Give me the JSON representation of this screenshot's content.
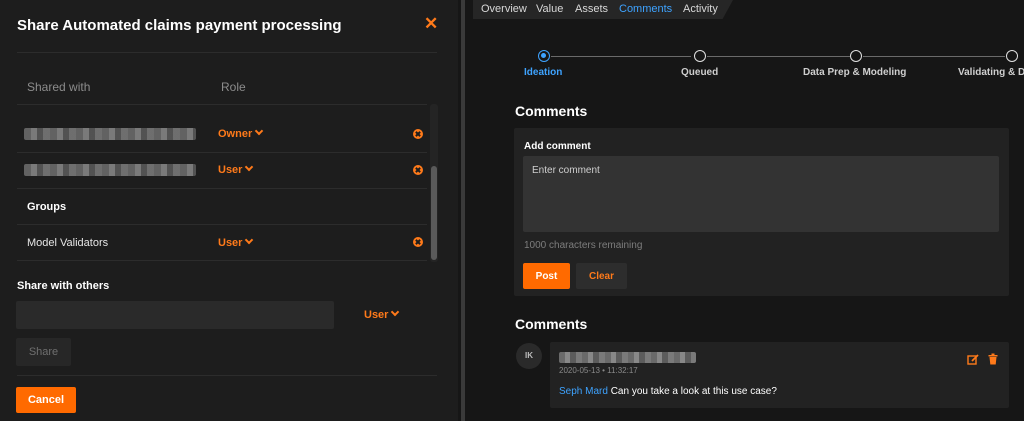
{
  "modal": {
    "title": "Share Automated claims payment processing",
    "close_icon": "close-icon",
    "columns": {
      "shared_with": "Shared with",
      "role": "Role"
    },
    "members": [
      {
        "name": "",
        "role": "Owner"
      },
      {
        "name": "",
        "role": "User"
      }
    ],
    "groups_label": "Groups",
    "groups": [
      {
        "name": "Model Validators",
        "role": "User"
      }
    ],
    "share_with_others_label": "Share with others",
    "share_input_value": "",
    "share_role": "User",
    "share_button": "Share",
    "cancel_button": "Cancel"
  },
  "tabs": [
    {
      "label": "Overview",
      "active": false
    },
    {
      "label": "Value",
      "active": false
    },
    {
      "label": "Assets",
      "active": false
    },
    {
      "label": "Comments",
      "active": true
    },
    {
      "label": "Activity",
      "active": false
    }
  ],
  "progress": {
    "steps": [
      {
        "label": "Ideation",
        "active": true
      },
      {
        "label": "Queued",
        "active": false
      },
      {
        "label": "Data Prep & Modeling",
        "active": false
      },
      {
        "label": "Validating & D",
        "active": false
      }
    ]
  },
  "comments_section": {
    "title": "Comments",
    "add_comment_label": "Add comment",
    "placeholder": "Enter comment",
    "chars_remaining": "1000 characters remaining",
    "post_button": "Post",
    "clear_button": "Clear"
  },
  "comment_list": {
    "title": "Comments",
    "items": [
      {
        "avatar_initials": "IK",
        "author": "",
        "timestamp": "2020-05-13 • 11:32:17",
        "mention": "Seph Mard",
        "text": "Can you take a look at this use case?"
      }
    ]
  },
  "colors": {
    "accent_orange": "#ff6a00",
    "accent_blue": "#3ea3ff",
    "background": "#161616",
    "modal_background": "#1d1d1d"
  }
}
